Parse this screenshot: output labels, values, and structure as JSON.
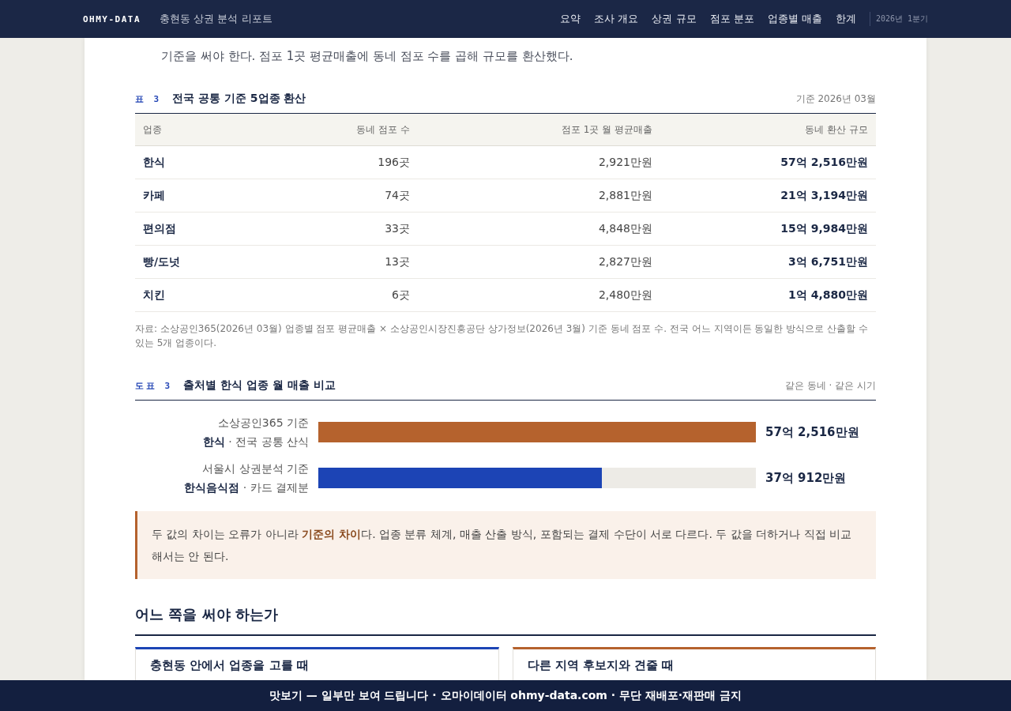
{
  "header": {
    "logo": "OHMY-DATA",
    "title": "충현동 상권 분석 리포트",
    "nav": [
      "요약",
      "조사 개요",
      "상권 규모",
      "점포 분포",
      "업종별 매출",
      "한계"
    ],
    "period": "2026년 1분기"
  },
  "intro": "기준을 써야 한다. 점포 1곳 평균매출에 동네 점포 수를 곱해 규모를 환산했다.",
  "table": {
    "number": "표 3",
    "title": "전국 공통 기준 5업종 환산",
    "note": "기준 2026년 03월",
    "columns": [
      "업종",
      "동네 점포 수",
      "점포 1곳 월 평균매출",
      "동네 환산 규모"
    ],
    "rows": [
      [
        "한식",
        "196곳",
        "2,921만원",
        "57억 2,516만원"
      ],
      [
        "카페",
        "74곳",
        "2,881만원",
        "21억 3,194만원"
      ],
      [
        "편의점",
        "33곳",
        "4,848만원",
        "15억 9,984만원"
      ],
      [
        "빵/도넛",
        "13곳",
        "2,827만원",
        "3억 6,751만원"
      ],
      [
        "치킨",
        "6곳",
        "2,480만원",
        "1억 4,880만원"
      ]
    ],
    "source": "자료: 소상공인365(2026년 03월) 업종별 점포 평균매출 × 소상공인시장진흥공단 상가정보(2026년 3월) 기준 동네 점포 수. 전국 어느 지역이든 동일한 방식으로 산출할 수 있는 5개 업종이다."
  },
  "chart": {
    "number": "도표 3",
    "title": "출처별 한식 업종 월 매출 비교",
    "note": "같은 동네 · 같은 시기",
    "bars": [
      {
        "label": "소상공인365 기준",
        "sublabel": "**한식** · 전국 공통 산식",
        "level": 1,
        "reading": "57억 2,516만원",
        "color": "#b5622d"
      },
      {
        "label": "서울시 상권분석 기준",
        "sublabel": "**한식음식점** · 카드 결제분",
        "level": 0.648,
        "reading": "37억 912만원",
        "color": "#1c44b5"
      }
    ]
  },
  "callout": "두 값의 차이는 오류가 아니라 **기준의 차이**다. 업종 분류 체계, 매출 산출 방식, 포함되는 결제 수단이 서로 다르다. 두 값을 더하거나 직접 비교해서는 안 된다.",
  "section": {
    "heading": "어느 쪽을 써야 하는가",
    "cards": [
      {
        "title": "충현동 안에서 업종을 고를 때",
        "color": "#1c44b5"
      },
      {
        "title": "다른 지역 후보지와 견줄 때",
        "color": "#b5622d"
      }
    ]
  },
  "banner": "맛보기 — 일부만 보여 드립니다 · 오마이데이터 ohmy-data.com · 무단 재배포·재판매 금지"
}
